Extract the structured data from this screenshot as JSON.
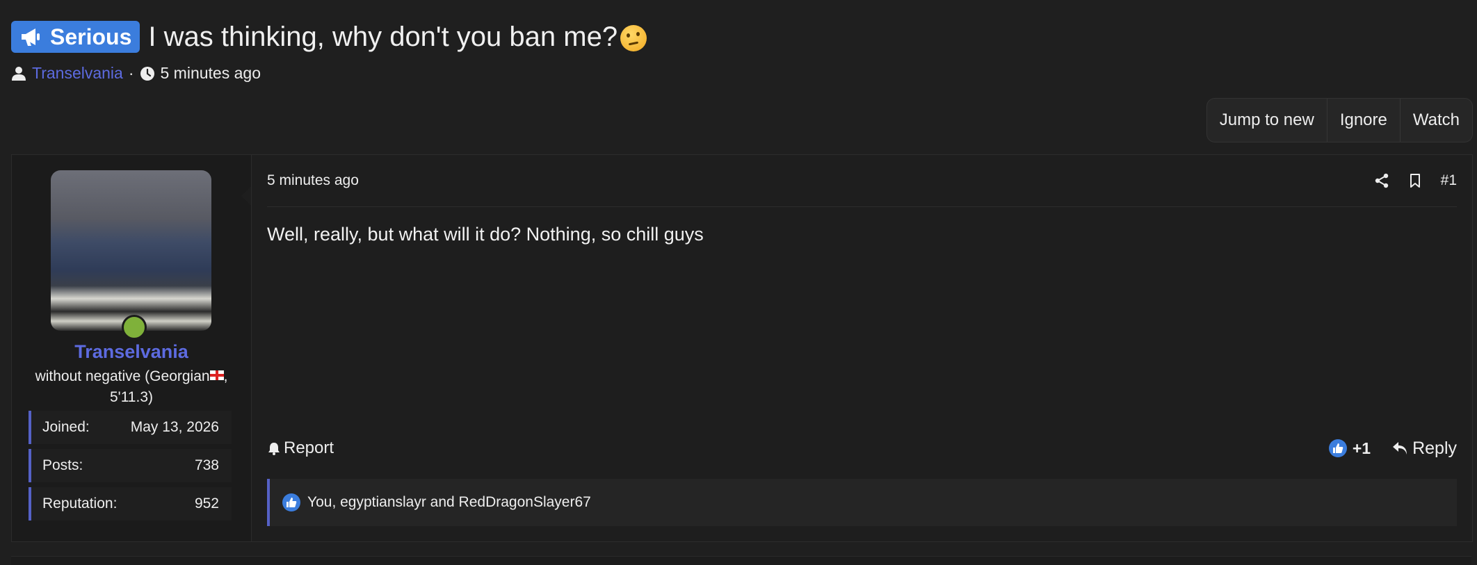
{
  "thread": {
    "prefix": "Serious",
    "title": "I was thinking, why don't you ban me?",
    "author": "Transelvania",
    "separator": "·",
    "time": "5 minutes ago"
  },
  "thread_actions": {
    "jump": "Jump to new",
    "ignore": "Ignore",
    "watch": "Watch"
  },
  "post": {
    "time": "5 minutes ago",
    "number": "#1",
    "body": "Well, really, but what will it do? Nothing, so chill guys",
    "report": "Report",
    "reaction_count": "+1",
    "reply": "Reply",
    "reactions_text": "You, egyptianslayr and RedDragonSlayer67"
  },
  "user": {
    "name": "Transelvania",
    "title_part1": "without negative (Georgian",
    "title_part2": ", 5'11.3)",
    "stats": [
      {
        "label": "Joined:",
        "value": "May 13, 2026"
      },
      {
        "label": "Posts:",
        "value": "738"
      },
      {
        "label": "Reputation:",
        "value": "952"
      }
    ],
    "online": true
  },
  "colors": {
    "accent": "#5d6be0",
    "prefix_bg": "#3b7ddd",
    "online": "#7fb13a",
    "background": "#1f1f1f"
  }
}
